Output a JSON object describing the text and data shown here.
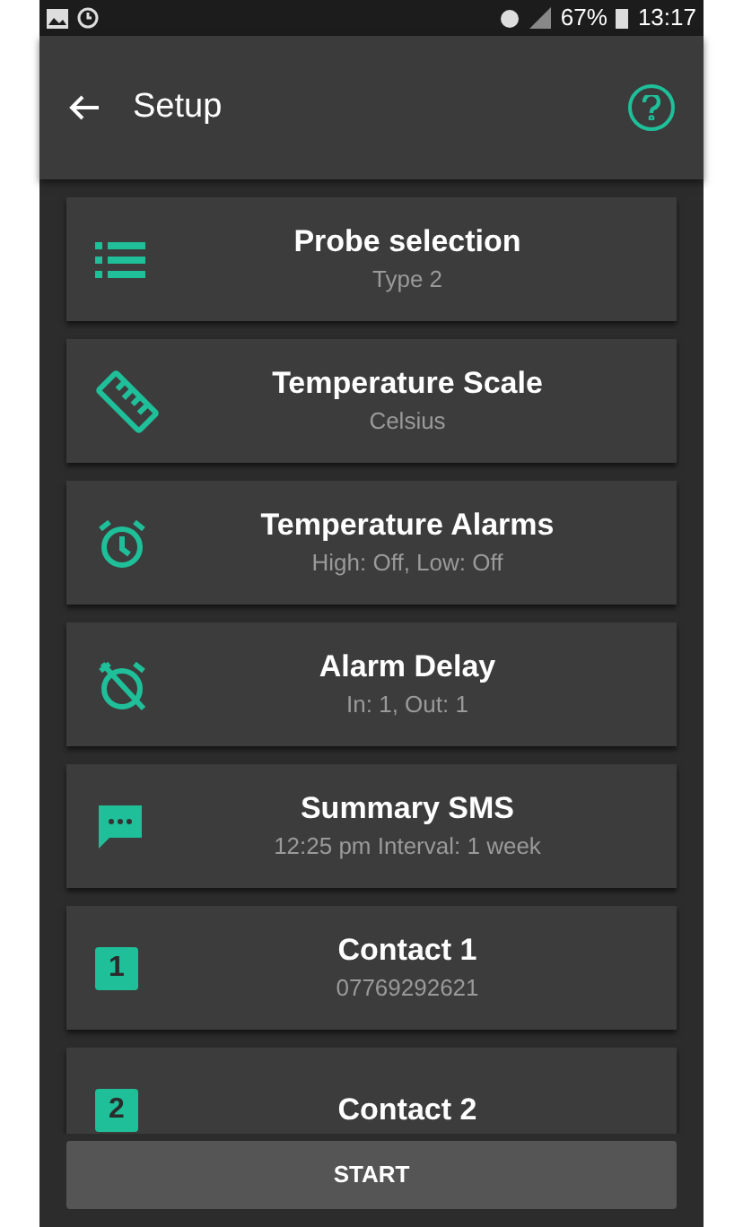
{
  "status_bar": {
    "battery": "67%",
    "time": "13:17"
  },
  "app_bar": {
    "title": "Setup"
  },
  "items": [
    {
      "kind": "list",
      "title": "Probe selection",
      "subtitle": "Type 2"
    },
    {
      "kind": "ruler",
      "title": "Temperature Scale",
      "subtitle": "Celsius"
    },
    {
      "kind": "alarm",
      "title": "Temperature Alarms",
      "subtitle": "High: Off, Low: Off"
    },
    {
      "kind": "alarm-off",
      "title": "Alarm Delay",
      "subtitle": "In: 1, Out: 1"
    },
    {
      "kind": "sms",
      "title": "Summary SMS",
      "subtitle": "12:25 pm Interval: 1 week"
    },
    {
      "kind": "number",
      "badge": "1",
      "title": "Contact 1",
      "subtitle": "07769292621"
    },
    {
      "kind": "number",
      "badge": "2",
      "title": "Contact 2"
    }
  ],
  "footer_button": "START"
}
